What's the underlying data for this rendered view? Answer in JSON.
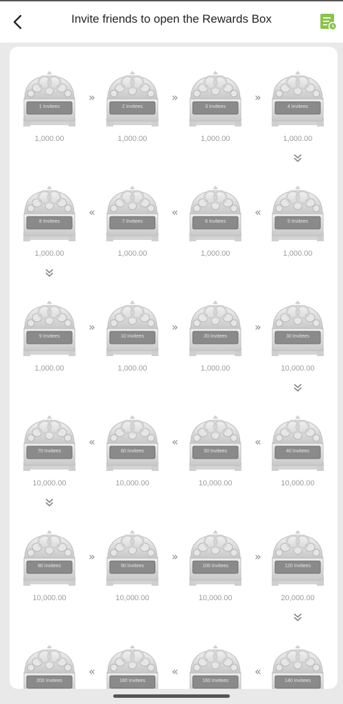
{
  "header": {
    "title": "Invite friends to open the Rewards Box",
    "back_icon": "chevron-left-icon",
    "records_icon": "records-list-icon",
    "records_icon_color": "#8bc34a"
  },
  "rewards": {
    "rows": [
      {
        "direction": "right",
        "items": [
          {
            "invitees": "1 Invitees",
            "amount": "1,000.00"
          },
          {
            "invitees": "2 Invitees",
            "amount": "1,000.00"
          },
          {
            "invitees": "3 Invitees",
            "amount": "1,000.00"
          },
          {
            "invitees": "4 Invitees",
            "amount": "1,000.00"
          }
        ]
      },
      {
        "direction": "left",
        "items": [
          {
            "invitees": "8 Invitees",
            "amount": "1,000.00"
          },
          {
            "invitees": "7 Invitees",
            "amount": "1,000.00"
          },
          {
            "invitees": "6 Invitees",
            "amount": "1,000.00"
          },
          {
            "invitees": "5 Invitees",
            "amount": "1,000.00"
          }
        ]
      },
      {
        "direction": "right",
        "items": [
          {
            "invitees": "9 Invitees",
            "amount": "1,000.00"
          },
          {
            "invitees": "10 Invitees",
            "amount": "1,000.00"
          },
          {
            "invitees": "20 Invitees",
            "amount": "1,000.00"
          },
          {
            "invitees": "30 Invitees",
            "amount": "10,000.00"
          }
        ]
      },
      {
        "direction": "left",
        "items": [
          {
            "invitees": "70 Invitees",
            "amount": "10,000.00"
          },
          {
            "invitees": "60 Invitees",
            "amount": "10,000.00"
          },
          {
            "invitees": "50 Invitees",
            "amount": "10,000.00"
          },
          {
            "invitees": "40 Invitees",
            "amount": "10,000.00"
          }
        ]
      },
      {
        "direction": "right",
        "items": [
          {
            "invitees": "80 Invitees",
            "amount": "10,000.00"
          },
          {
            "invitees": "90 Invitees",
            "amount": "10,000.00"
          },
          {
            "invitees": "100 Invitees",
            "amount": "10,000.00"
          },
          {
            "invitees": "120 Invitees",
            "amount": "20,000.00"
          }
        ]
      },
      {
        "direction": "left",
        "items": [
          {
            "invitees": "200 Invitees",
            "amount": ""
          },
          {
            "invitees": "180 Invitees",
            "amount": ""
          },
          {
            "invitees": "160 Invitees",
            "amount": ""
          },
          {
            "invitees": "140 Invitees",
            "amount": ""
          }
        ]
      }
    ],
    "arrow_right_glyph": "»",
    "arrow_left_glyph": "«",
    "arrow_down_icon": "double-chevron-down-icon",
    "box_icon": "treasure-chest-icon"
  }
}
